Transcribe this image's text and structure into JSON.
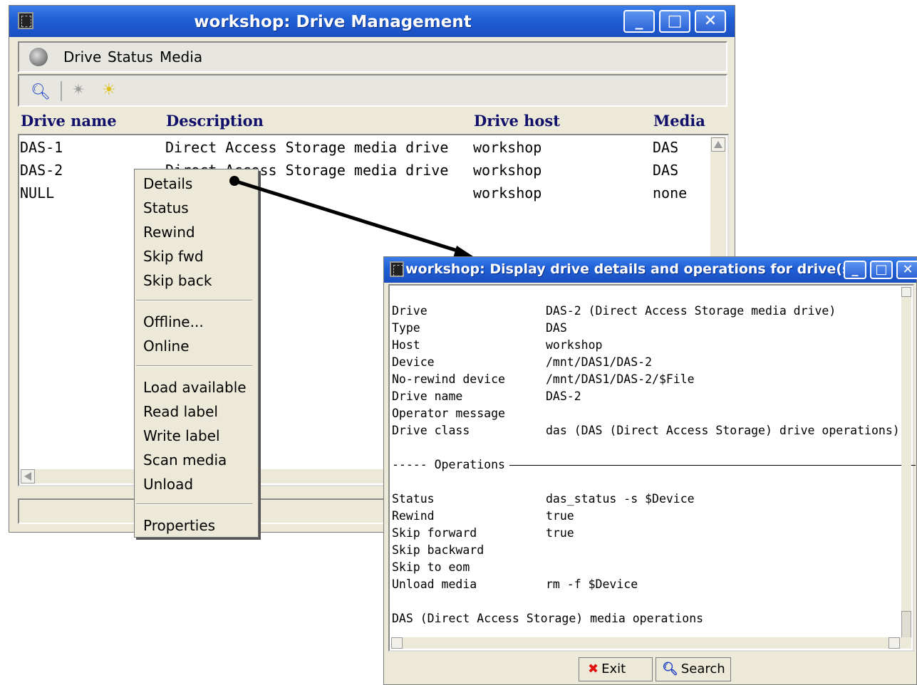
{
  "main_window": {
    "title": "workshop: Drive Management",
    "buttons": {
      "minimize": "_",
      "maximize": "□",
      "close": "✕"
    },
    "menus": [
      {
        "label": "Drive"
      },
      {
        "label": "Status"
      },
      {
        "label": "Media"
      }
    ],
    "toolbar_icons": [
      "search-icon",
      "wand-icon",
      "lightbulb-icon"
    ],
    "columns": [
      "Drive name",
      "Description",
      "Drive host",
      "Media"
    ],
    "rows": [
      {
        "name": "DAS-1",
        "description": "Direct Access Storage media drive",
        "host": "workshop",
        "media": "DAS"
      },
      {
        "name": "DAS-2",
        "description": "Direct Access Storage media drive",
        "host": "workshop",
        "media": "DAS"
      },
      {
        "name": "NULL",
        "description": "",
        "host": "workshop",
        "media": "none"
      }
    ]
  },
  "context_menu": {
    "items": [
      "Details",
      "Status",
      "Rewind",
      "Skip fwd",
      "Skip back",
      "Offline...",
      "Online",
      "Load available",
      "Read label",
      "Write label",
      "Scan media",
      "Unload",
      "Properties"
    ]
  },
  "details_window": {
    "title": "workshop: Display drive details and operations for drive(s)",
    "fields": [
      {
        "key": "Drive",
        "value": "DAS-2 (Direct Access Storage media drive)"
      },
      {
        "key": "Type",
        "value": "DAS"
      },
      {
        "key": "Host",
        "value": "workshop"
      },
      {
        "key": "Device",
        "value": "/mnt/DAS1/DAS-2"
      },
      {
        "key": "No-rewind device",
        "value": "/mnt/DAS1/DAS-2/$File"
      },
      {
        "key": "Drive name",
        "value": "DAS-2"
      },
      {
        "key": "Operator message",
        "value": ""
      },
      {
        "key": "Drive class",
        "value": "das (DAS (Direct Access Storage) drive operations)"
      }
    ],
    "operations_heading": "----- Operations",
    "operations": [
      {
        "key": "Status",
        "value": "das_status -s $Device"
      },
      {
        "key": "Rewind",
        "value": "true"
      },
      {
        "key": "Skip forward",
        "value": "true"
      },
      {
        "key": "Skip backward",
        "value": ""
      },
      {
        "key": "Skip to eom",
        "value": ""
      },
      {
        "key": "Unload media",
        "value": "rm -f $Device"
      }
    ],
    "footer_line": "DAS (Direct Access Storage) media operations",
    "exit_label": "Exit",
    "search_label": "Search"
  }
}
